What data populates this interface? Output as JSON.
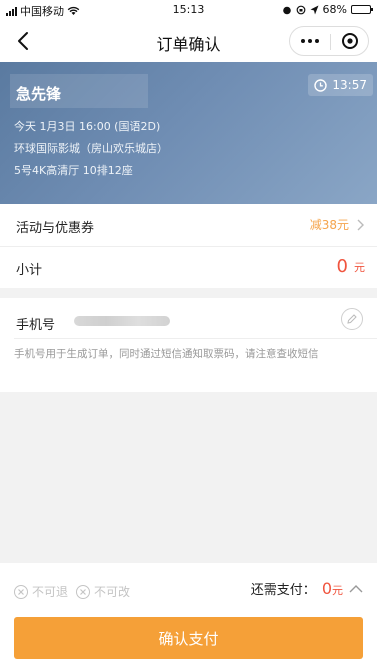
{
  "status_bar": {
    "carrier": "中国移动",
    "time": "15:13",
    "battery": "68%",
    "battery_level": 0.68
  },
  "nav": {
    "title": "订单确认"
  },
  "movie": {
    "title": "急先锋",
    "countdown": "13:57",
    "showtime": "今天 1月3日 16:00 (国语2D)",
    "cinema": "环球国际影城（房山欢乐城店）",
    "seat": "5号4K高清厅 10排12座"
  },
  "promo": {
    "label": "活动与优惠券",
    "value": "减38元"
  },
  "subtotal": {
    "label": "小计",
    "amount": "0",
    "unit": "元"
  },
  "phone": {
    "label": "手机号",
    "note": "手机号用于生成订单，同时通过短信通知取票码，请注意查收短信"
  },
  "footer": {
    "no_refund": "不可退",
    "no_change": "不可改",
    "need_pay_label": "还需支付：",
    "need_pay_amount": "0",
    "need_pay_unit": "元",
    "confirm_label": "确认支付"
  },
  "colors": {
    "accent_orange": "#f5a038",
    "price_red": "#f0543e",
    "discount_orange": "#f5a44c"
  }
}
